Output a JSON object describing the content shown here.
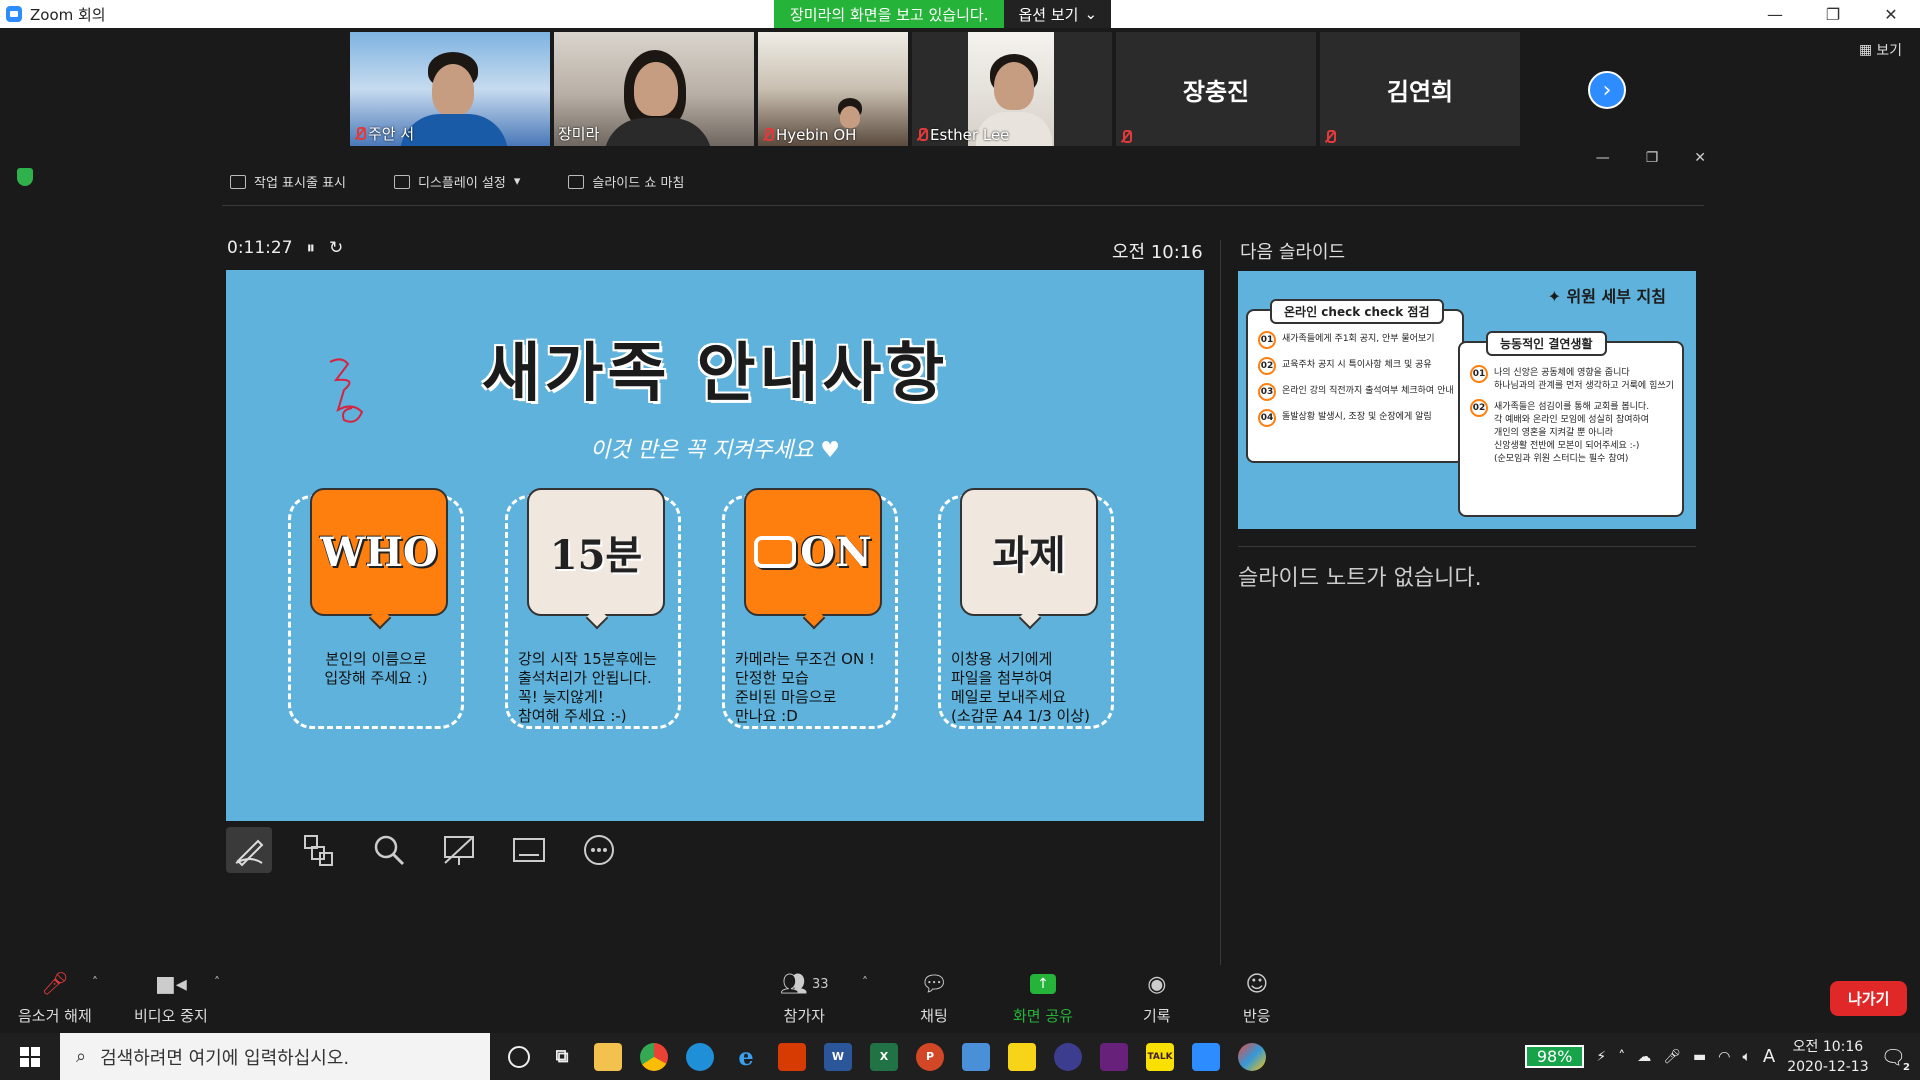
{
  "window": {
    "title": "Zoom 회의"
  },
  "share_banner": {
    "viewing": "장미라의 화면을 보고 있습니다.",
    "options": "옵션 보기"
  },
  "view_button": "보기",
  "participants": [
    {
      "name": "주안 서",
      "muted": true
    },
    {
      "name": "장미라",
      "muted": false,
      "active_speaker": true
    },
    {
      "name": "Hyebin OH",
      "muted": true
    },
    {
      "name": "Esther Lee",
      "muted": true
    },
    {
      "name": "장충진",
      "muted": true,
      "video": false
    },
    {
      "name": "김연희",
      "muted": true,
      "video": false
    }
  ],
  "presenter_toolbar": {
    "taskbar": "작업 표시줄 표시",
    "display": "디스플레이 설정",
    "end": "슬라이드 쇼 마침"
  },
  "presenter": {
    "elapsed": "0:11:27",
    "clock": "오전 10:16",
    "next_slide_label": "다음 슬라이드",
    "notes": "슬라이드 노트가 없습니다."
  },
  "slide": {
    "title": "새가족 안내사항",
    "subtitle": "이것 만은 꼭 지켜주세요 ♥",
    "cards": [
      {
        "badge": "WHO",
        "text": "본인의 이름으로\n입장해 주세요 :)"
      },
      {
        "badge": "15분",
        "text": "강의 시작 15분후에는\n출석처리가 안됩니다.\n꼭! 늦지않게!\n참여해 주세요 :-)"
      },
      {
        "badge": "ON",
        "text": "카메라는 무조건 ON !\n단정한 모습\n준비된 마음으로\n만나요 :D"
      },
      {
        "badge": "과제",
        "text": "이창용 서기에게\n파일을 첨부하여\n메일로 보내주세요\n(소감문 A4 1/3 이상)"
      }
    ]
  },
  "next_slide": {
    "title": "✦ 위원 세부 지침",
    "left_tab": "온라인 check check 점검",
    "left_items": [
      {
        "num": "01",
        "text": "새가족들에게 주1회 공지, 안부 물어보기"
      },
      {
        "num": "02",
        "text": "교육주차 공지 시 특이사항 체크 및 공유"
      },
      {
        "num": "03",
        "text": "온라인 강의 직전까지 출석여부 체크하여 안내"
      },
      {
        "num": "04",
        "text": "돌발상황 발생시, 조장 및 순장에게 알림"
      }
    ],
    "right_tab": "능동적인 결연생활",
    "right_items": [
      {
        "num": "01",
        "text": "나의 신앙은 공동체에 영향을 줍니다\n하나님과의 관계를 먼저 생각하고 거룩에 힘쓰기"
      },
      {
        "num": "02",
        "text": "새가족들은 섬김이를 통해 교회를 봅니다.\n각 예배와 온라인 모임에 성실히 참여하여\n개인의 영혼을 지켜갈 뿐 아니라\n신앙생활 전반에 모본이 되어주세요 :-)\n(순모임과 위원 스터디는 필수 참여)"
      }
    ]
  },
  "controls": {
    "unmute": "음소거 해제",
    "stop_video": "비디오 중지",
    "participants": "참가자",
    "participant_count": "33",
    "chat": "채팅",
    "share": "화면 공유",
    "record": "기록",
    "reactions": "반응",
    "leave": "나가기"
  },
  "taskbar": {
    "search_placeholder": "검색하려면 여기에 입력하십시오.",
    "battery": "98%",
    "time": "오전 10:16",
    "date": "2020-12-13",
    "ime": "A",
    "notif_count": "2"
  },
  "colors": {
    "share_green": "#25b439",
    "zoom_blue": "#2d8cff",
    "slide_bg": "#5fb2db",
    "accent_orange": "#ff7f0e",
    "leave_red": "#e02828"
  }
}
